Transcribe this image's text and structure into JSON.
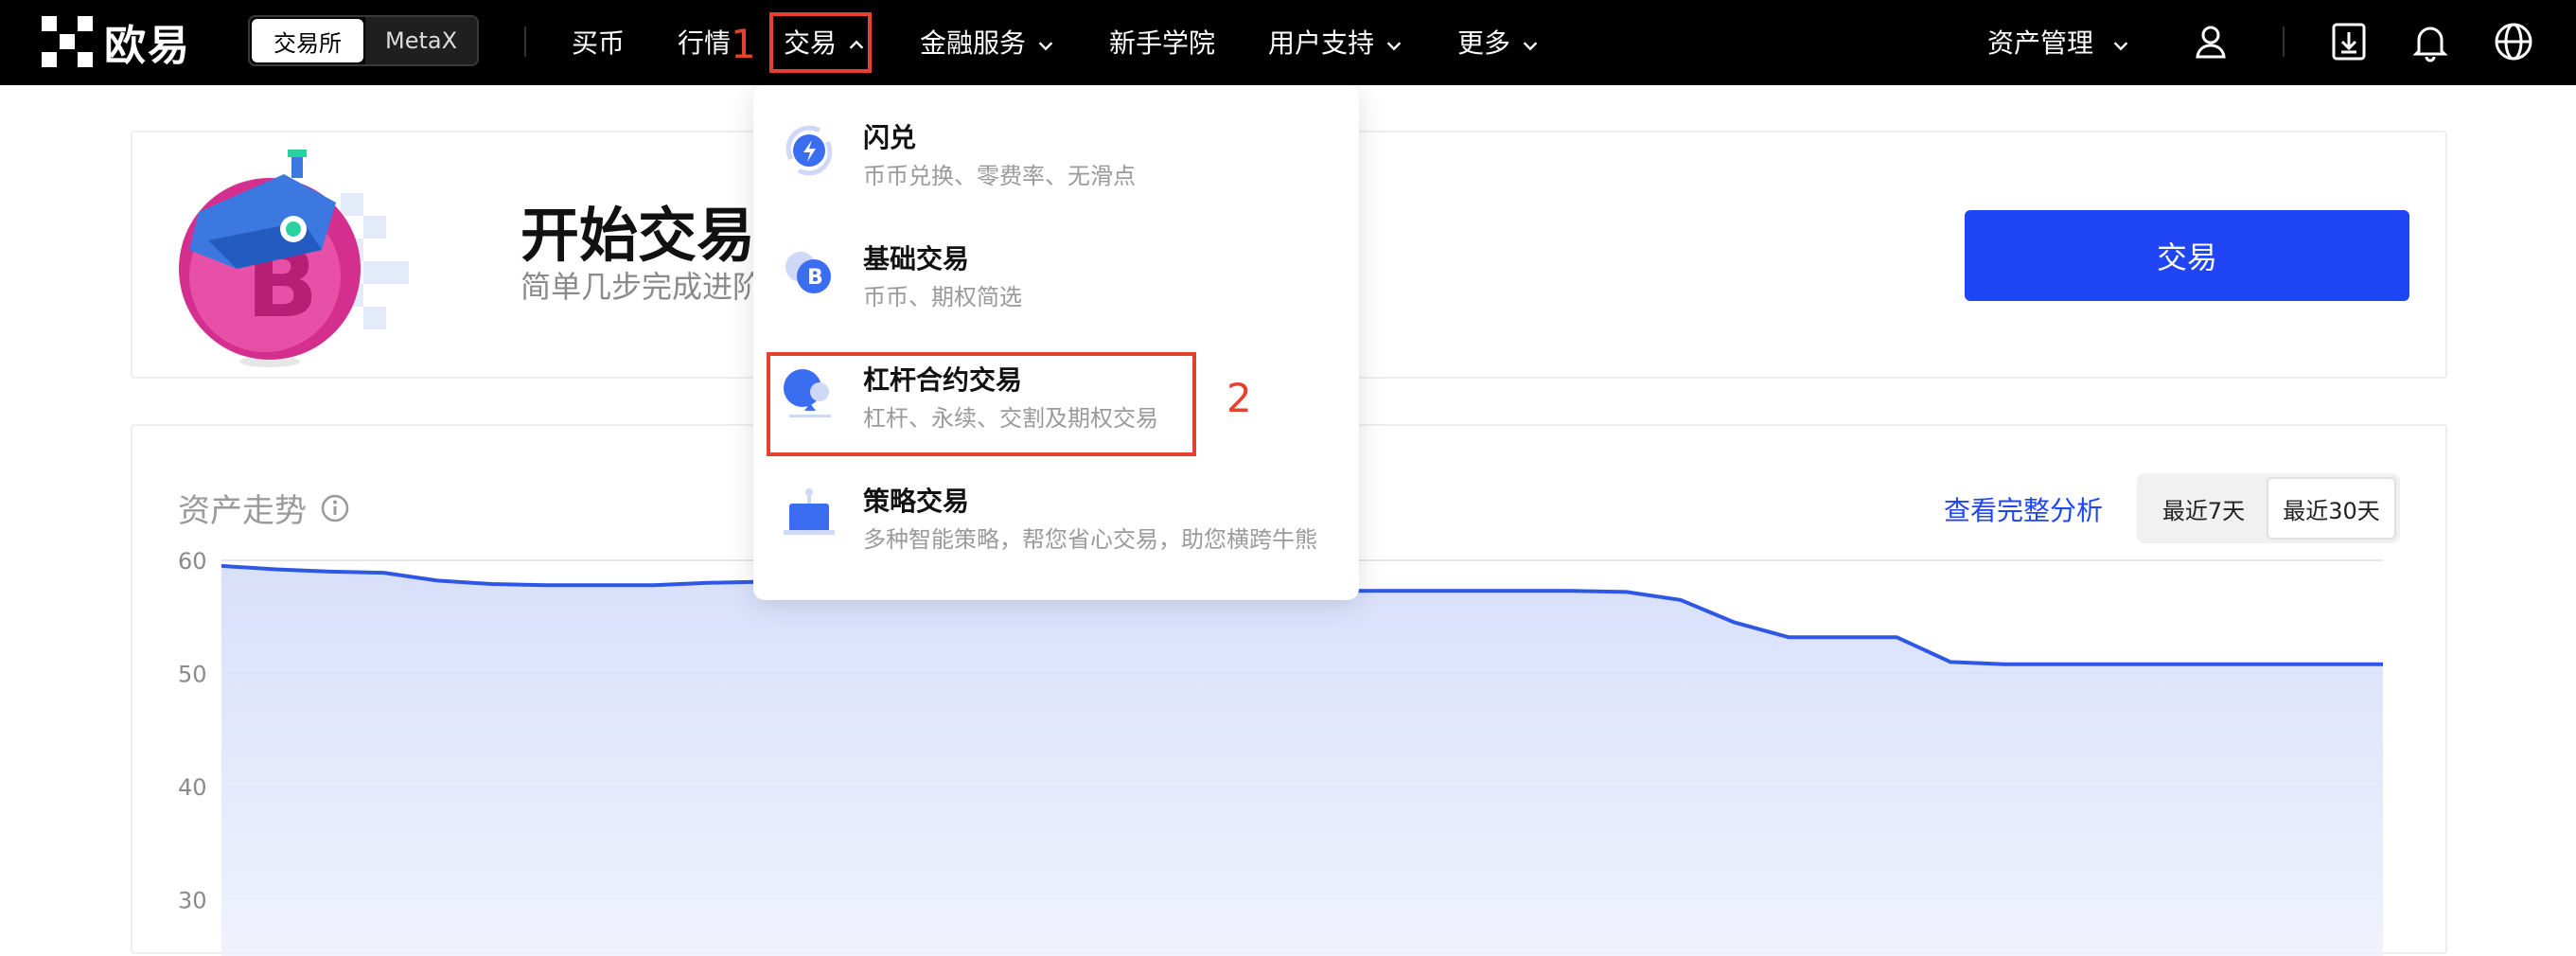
{
  "brand": {
    "name": "欧易"
  },
  "header": {
    "segment": [
      "交易所",
      "MetaX"
    ],
    "nav": [
      {
        "label": "买币"
      },
      {
        "label": "行情"
      },
      {
        "label": "交易"
      },
      {
        "label": "金融服务"
      },
      {
        "label": "新手学院"
      },
      {
        "label": "用户支持"
      },
      {
        "label": "更多"
      }
    ],
    "asset_mgmt": "资产管理"
  },
  "annotations": {
    "step1": "1",
    "step2": "2"
  },
  "dropdown": {
    "items": [
      {
        "title": "闪兑",
        "desc": "币币兑换、零费率、无滑点",
        "icon": "flash-swap-icon"
      },
      {
        "title": "基础交易",
        "desc": "币币、期权简选",
        "icon": "bitcoin-icon"
      },
      {
        "title": "杠杆合约交易",
        "desc": "杠杆、永续、交割及期权交易",
        "icon": "leverage-icon"
      },
      {
        "title": "策略交易",
        "desc": "多种智能策略，帮您省心交易，助您横跨牛熊",
        "icon": "strategy-bot-icon"
      }
    ]
  },
  "banner": {
    "title": "开始交易",
    "subtitle": "简单几步完成进阶",
    "button": "交易"
  },
  "asset": {
    "title": "资产走势",
    "link": "查看完整分析",
    "ranges": [
      "最近7天",
      "最近30天"
    ],
    "active_range": "最近30天"
  },
  "colors": {
    "accent": "#1f45f5",
    "annotation": "#e4412e",
    "topbar": "#000000"
  },
  "chart_data": {
    "type": "area",
    "y_ticks": [
      "60",
      "50",
      "40",
      "30"
    ],
    "ylim": [
      25,
      61
    ],
    "values": [
      59.5,
      59.2,
      59.0,
      58.9,
      58.2,
      57.9,
      57.8,
      57.8,
      57.8,
      58.0,
      58.1,
      58.1,
      57.4,
      57.3,
      57.3,
      57.3,
      57.3,
      57.3,
      57.3,
      57.3,
      57.3,
      57.3,
      57.3,
      57.3,
      57.3,
      57.3,
      57.2,
      56.5,
      54.5,
      53.2,
      53.2,
      53.2,
      51.0,
      50.8,
      50.8,
      50.8,
      50.8,
      50.8,
      50.8,
      50.8,
      50.8
    ],
    "grid": true
  }
}
